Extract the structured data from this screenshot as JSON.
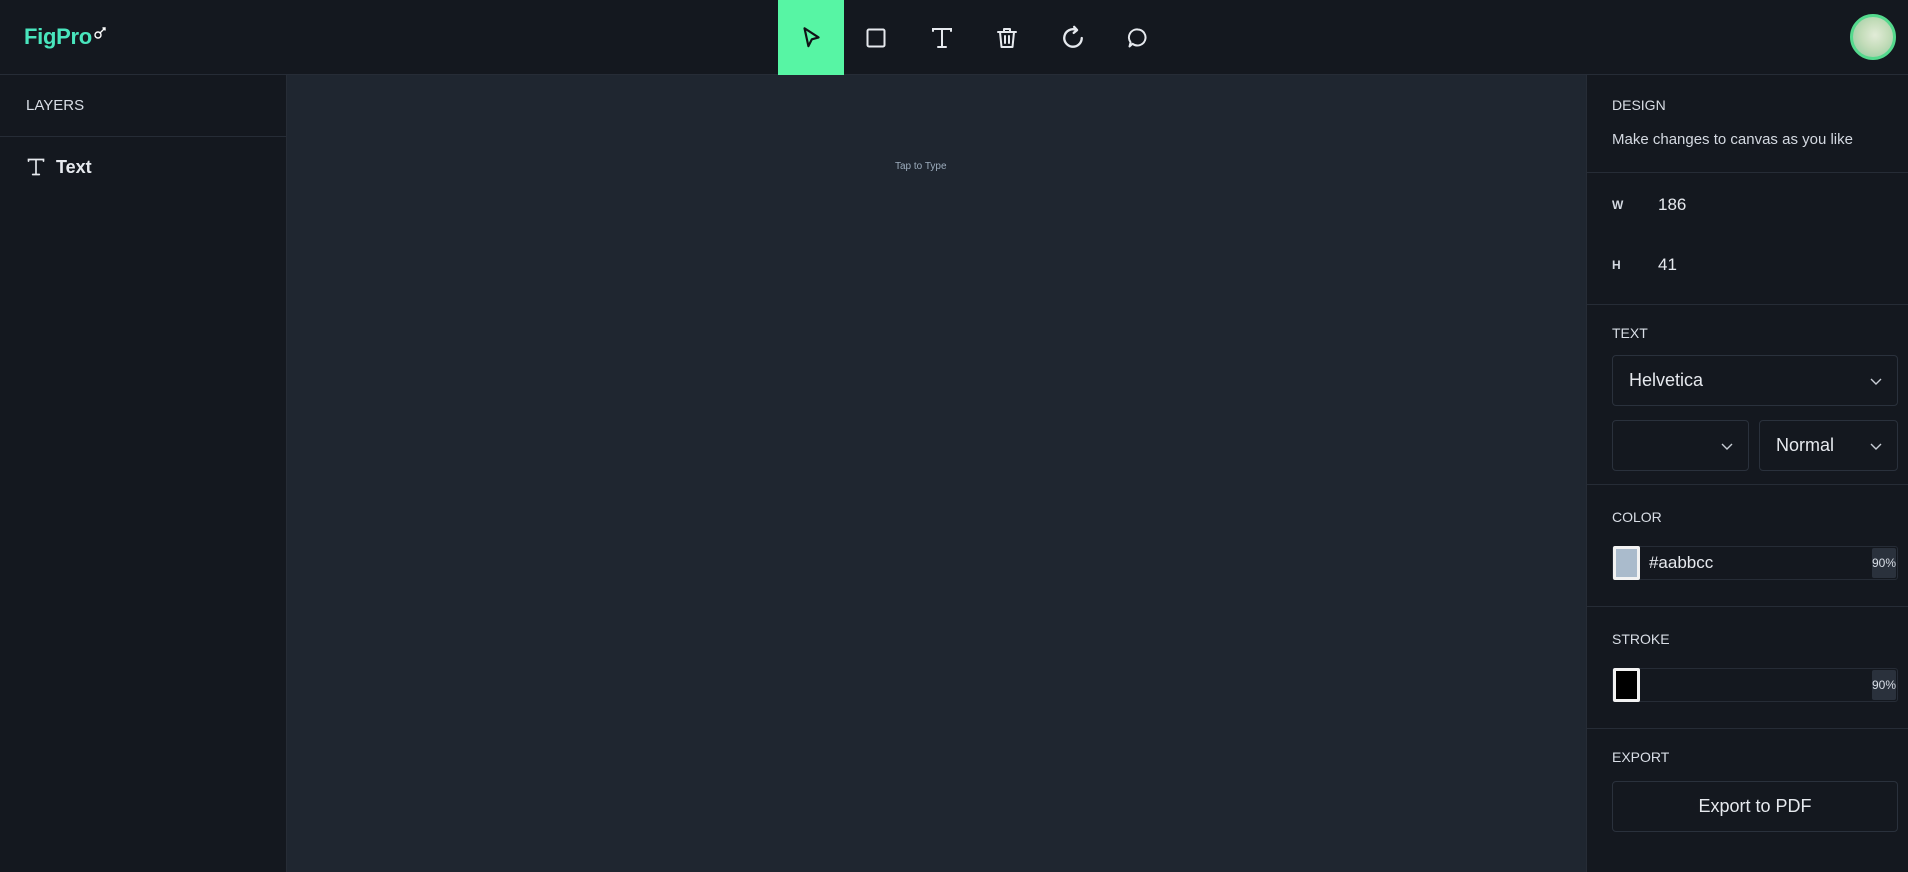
{
  "app": {
    "logo_text": "FigPro",
    "brand_color": "#49e5bd",
    "accent_color": "#57f5a4"
  },
  "toolbar": {
    "tools": [
      {
        "name": "select",
        "icon": "cursor-icon",
        "active": true
      },
      {
        "name": "rectangle",
        "icon": "square-icon",
        "active": false
      },
      {
        "name": "text",
        "icon": "text-icon",
        "active": false
      },
      {
        "name": "delete",
        "icon": "trash-icon",
        "active": false
      },
      {
        "name": "reset",
        "icon": "refresh-icon",
        "active": false
      },
      {
        "name": "comments",
        "icon": "comment-icon",
        "active": false
      }
    ]
  },
  "layers": {
    "title": "LAYERS",
    "items": [
      {
        "label": "Text",
        "icon": "text-icon"
      }
    ]
  },
  "canvas": {
    "text_object": "Tap to Type"
  },
  "design": {
    "title": "DESIGN",
    "subtitle": "Make changes to canvas as you like",
    "width_label": "W",
    "width_value": "186",
    "height_label": "H",
    "height_value": "41"
  },
  "text": {
    "title": "TEXT",
    "font_family": "Helvetica",
    "font_size": "",
    "font_weight": "Normal"
  },
  "color": {
    "title": "COLOR",
    "hex": "#aabbcc",
    "swatch": "#aabbcc",
    "opacity": "90%"
  },
  "stroke": {
    "title": "STROKE",
    "hex": "",
    "swatch": "#000000",
    "opacity": "90%"
  },
  "export": {
    "title": "EXPORT",
    "button_label": "Export to PDF"
  }
}
